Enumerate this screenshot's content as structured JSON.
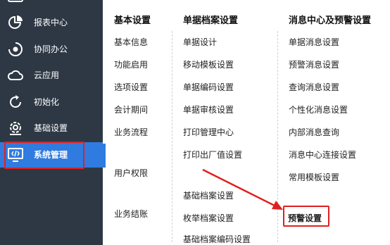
{
  "sidebar": {
    "items": [
      {
        "label": "报表中心",
        "icon": "pie-chart-icon"
      },
      {
        "label": "协同办公",
        "icon": "collaboration-icon"
      },
      {
        "label": "云应用",
        "icon": "cloud-icon"
      },
      {
        "label": "初始化",
        "icon": "refresh-icon"
      },
      {
        "label": "基础设置",
        "icon": "settings-icon"
      },
      {
        "label": "系统管理",
        "icon": "monitor-code-icon",
        "active": true
      }
    ]
  },
  "menu": {
    "columns": [
      {
        "title": "基本设置",
        "items": [
          "基本信息",
          "功能启用",
          "选项设置",
          "会计期间",
          "业务流程",
          "用户权限",
          "业务结账"
        ]
      },
      {
        "title": "单据档案设置",
        "items": [
          "单据设计",
          "移动模板设置",
          "单据编码设置",
          "单据审核设置",
          "打印管理中心",
          "打印出厂值设置",
          "基础档案设置",
          "枚举档案设置",
          "基础档案编码设置"
        ]
      },
      {
        "title": "消息中心及预警设置",
        "items": [
          "单据消息设置",
          "预警消息设置",
          "查询消息设置",
          "个性化消息设置",
          "内部消息查询",
          "消息中心连接设置",
          "常用模板设置",
          "预警设置"
        ]
      }
    ]
  },
  "colors": {
    "sidebar_bg": "#2e3845",
    "active_bg": "#2f7be0",
    "highlight": "#e02020"
  }
}
